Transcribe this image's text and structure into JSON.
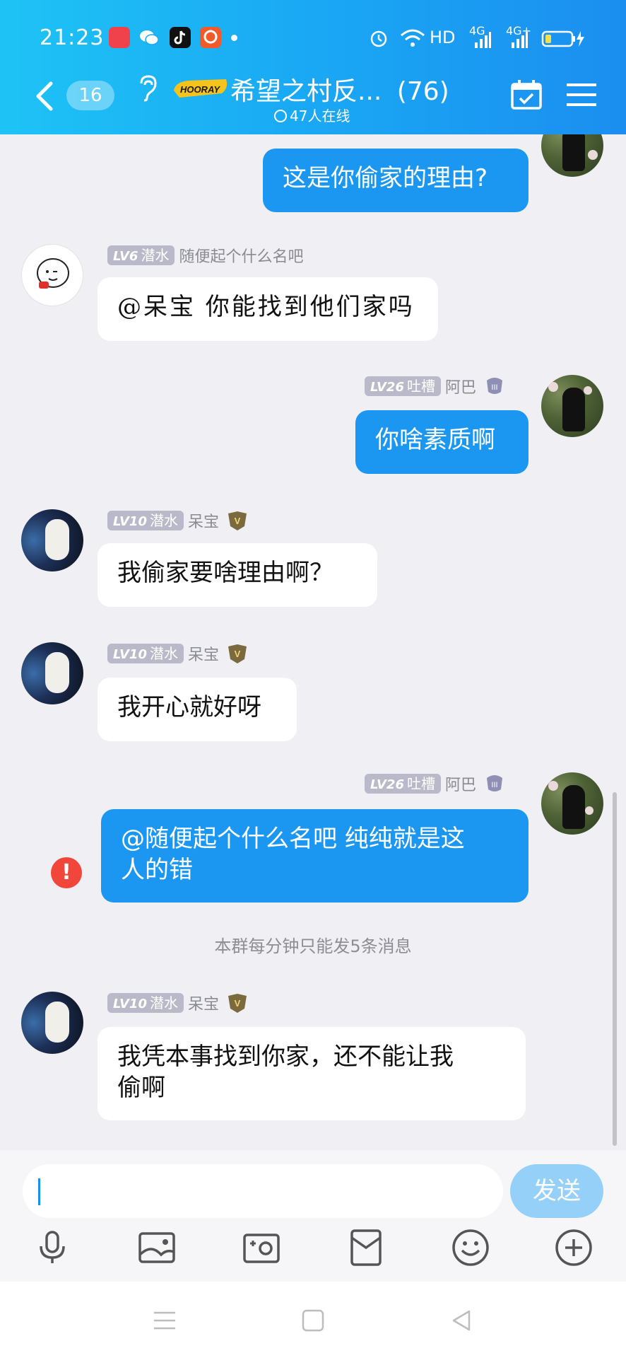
{
  "status_bar": {
    "time": "21:23",
    "network_label": "HD",
    "signal_1": "4G",
    "signal_2": "4G+"
  },
  "header": {
    "unread_count": "16",
    "group_name": "希望之村反...",
    "member_count": "(76)",
    "online_text": "47人在线",
    "logo_text": "HOORAY",
    "accent_color": "#1aa8f4"
  },
  "messages": [
    {
      "side": "right",
      "text": "这是你偷家的理由?"
    },
    {
      "side": "left",
      "level": "LV6",
      "title": "潜水",
      "name": "随便起个什么名吧",
      "text": "@呆宝 你能找到他们家吗"
    },
    {
      "side": "right",
      "level": "LV26",
      "title": "吐槽",
      "name": "阿巴",
      "text": "你啥素质啊"
    },
    {
      "side": "left",
      "level": "LV10",
      "title": "潜水",
      "name": "呆宝",
      "text": "我偷家要啥理由啊？"
    },
    {
      "side": "left",
      "level": "LV10",
      "title": "潜水",
      "name": "呆宝",
      "text": "我开心就好呀"
    },
    {
      "side": "right",
      "level": "LV26",
      "title": "吐槽",
      "name": "阿巴",
      "text_line1": "@随便起个什么名吧 纯纯就是这",
      "text_line2": "人的错",
      "error": "!"
    },
    {
      "side": "left",
      "level": "LV10",
      "title": "潜水",
      "name": "呆宝",
      "text_line1": "我凭本事找到你家，还不能让我",
      "text_line2": "偷啊"
    }
  ],
  "system_notice": "本群每分钟只能发5条消息",
  "input": {
    "placeholder": "",
    "send_label": "发送"
  },
  "toolbar_icons": [
    "microphone-icon",
    "image-icon",
    "camera-icon",
    "red-packet-icon",
    "emoji-icon",
    "plus-icon"
  ],
  "nav_icons": [
    "menu-nav-icon",
    "home-nav-icon",
    "back-nav-icon"
  ]
}
